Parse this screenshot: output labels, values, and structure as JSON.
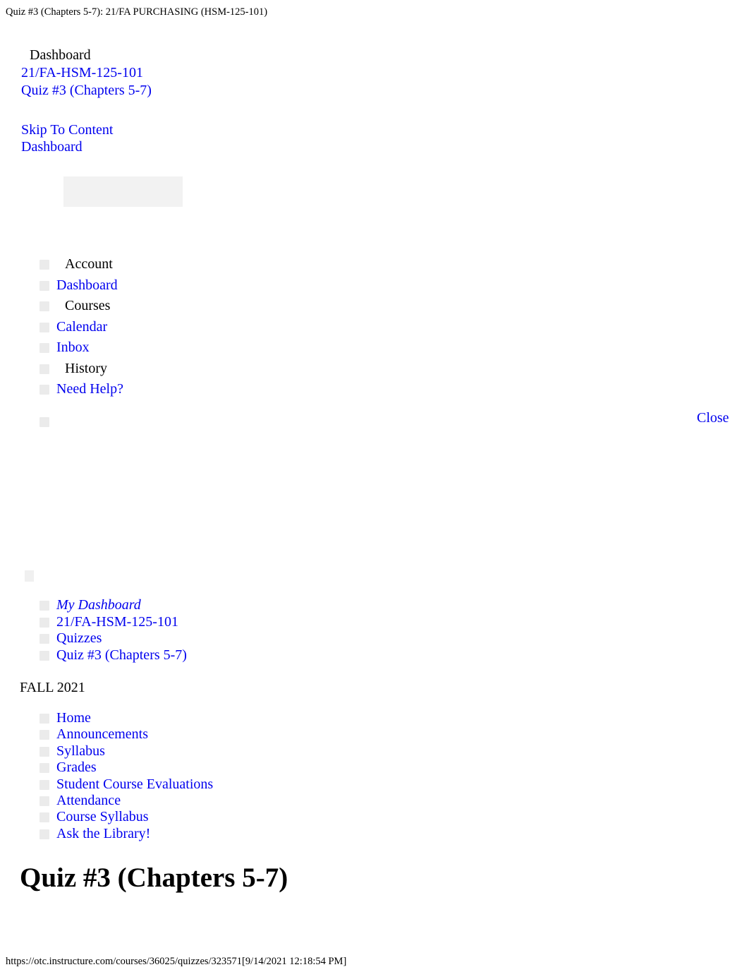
{
  "document": {
    "print_header": "Quiz #3 (Chapters 5-7): 21/FA PURCHASING (HSM-125-101)",
    "footer_url": "https://otc.instructure.com/courses/36025/quizzes/323571[9/14/2021 12:18:54 PM]"
  },
  "colors": {
    "link": "#0000EE",
    "text": "#000000",
    "ghost": "#ebebeb",
    "background": "#ffffff"
  },
  "top_strip": {
    "dashboard_label": "Dashboard",
    "course_link": "21/FA-HSM-125-101",
    "quiz_link": "Quiz #3 (Chapters 5-7)"
  },
  "skip_block": {
    "skip_to_content": "Skip To Content",
    "dashboard": "Dashboard"
  },
  "global_nav": {
    "items": [
      {
        "label": "Account",
        "is_link": false
      },
      {
        "label": "Dashboard",
        "is_link": true
      },
      {
        "label": "Courses",
        "is_link": false
      },
      {
        "label": "Calendar",
        "is_link": true
      },
      {
        "label": "Inbox",
        "is_link": true
      },
      {
        "label": "History",
        "is_link": false
      },
      {
        "label": "Need Help?",
        "is_link": true
      },
      {
        "label": "",
        "is_link": false
      }
    ]
  },
  "close_link": "Close",
  "breadcrumbs": {
    "items": [
      {
        "label": "My Dashboard",
        "italic": true
      },
      {
        "label": "21/FA-HSM-125-101",
        "italic": false
      },
      {
        "label": "Quizzes",
        "italic": false
      },
      {
        "label": "Quiz #3 (Chapters 5-7)",
        "italic": false
      }
    ]
  },
  "term_label": "FALL 2021",
  "course_nav": {
    "items": [
      {
        "label": "Home"
      },
      {
        "label": "Announcements"
      },
      {
        "label": "Syllabus"
      },
      {
        "label": "Grades"
      },
      {
        "label": "Student Course Evaluations"
      },
      {
        "label": "Attendance"
      },
      {
        "label": "Course Syllabus"
      },
      {
        "label": "Ask the Library!"
      }
    ]
  },
  "main": {
    "page_title": "Quiz #3 (Chapters 5-7)"
  }
}
